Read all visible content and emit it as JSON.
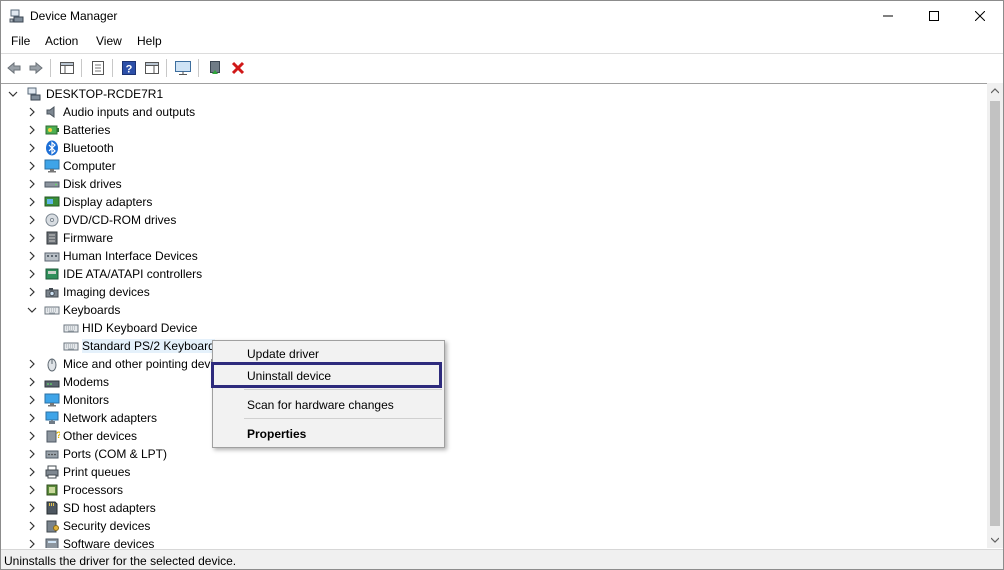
{
  "window": {
    "title": "Device Manager"
  },
  "menu": [
    "File",
    "Action",
    "View",
    "Help"
  ],
  "tree": {
    "root": "DESKTOP-RCDE7R1",
    "categories": [
      {
        "label": "Audio inputs and outputs",
        "icon": "speaker-icon"
      },
      {
        "label": "Batteries",
        "icon": "battery-icon"
      },
      {
        "label": "Bluetooth",
        "icon": "bluetooth-icon"
      },
      {
        "label": "Computer",
        "icon": "computer-icon"
      },
      {
        "label": "Disk drives",
        "icon": "disk-drive-icon"
      },
      {
        "label": "Display adapters",
        "icon": "display-adapter-icon"
      },
      {
        "label": "DVD/CD-ROM drives",
        "icon": "dvd-icon"
      },
      {
        "label": "Firmware",
        "icon": "firmware-icon"
      },
      {
        "label": "Human Interface Devices",
        "icon": "hid-icon"
      },
      {
        "label": "IDE ATA/ATAPI controllers",
        "icon": "ide-icon"
      },
      {
        "label": "Imaging devices",
        "icon": "camera-icon"
      },
      {
        "label": "Keyboards",
        "icon": "keyboard-icon"
      },
      {
        "label": "HID Keyboard Device",
        "icon": "keyboard-icon"
      },
      {
        "label": "Standard PS/2 Keyboard",
        "icon": "keyboard-icon"
      },
      {
        "label": "Mice and other pointing devices",
        "icon": "mouse-icon"
      },
      {
        "label": "Modems",
        "icon": "modem-icon"
      },
      {
        "label": "Monitors",
        "icon": "monitor-icon"
      },
      {
        "label": "Network adapters",
        "icon": "network-icon"
      },
      {
        "label": "Other devices",
        "icon": "other-device-icon"
      },
      {
        "label": "Ports (COM & LPT)",
        "icon": "port-icon"
      },
      {
        "label": "Print queues",
        "icon": "printer-icon"
      },
      {
        "label": "Processors",
        "icon": "processor-icon"
      },
      {
        "label": "SD host adapters",
        "icon": "sd-card-icon"
      },
      {
        "label": "Security devices",
        "icon": "security-icon"
      },
      {
        "label": "Software devices",
        "icon": "software-icon"
      }
    ]
  },
  "context_menu": {
    "update": "Update driver",
    "uninstall": "Uninstall device",
    "scan": "Scan for hardware changes",
    "properties": "Properties"
  },
  "status": "Uninstalls the driver for the selected device.",
  "colors": {
    "highlight_border": "#2e2b7d",
    "selection": "#e5f1fb",
    "uninstall_red": "#d01818"
  }
}
